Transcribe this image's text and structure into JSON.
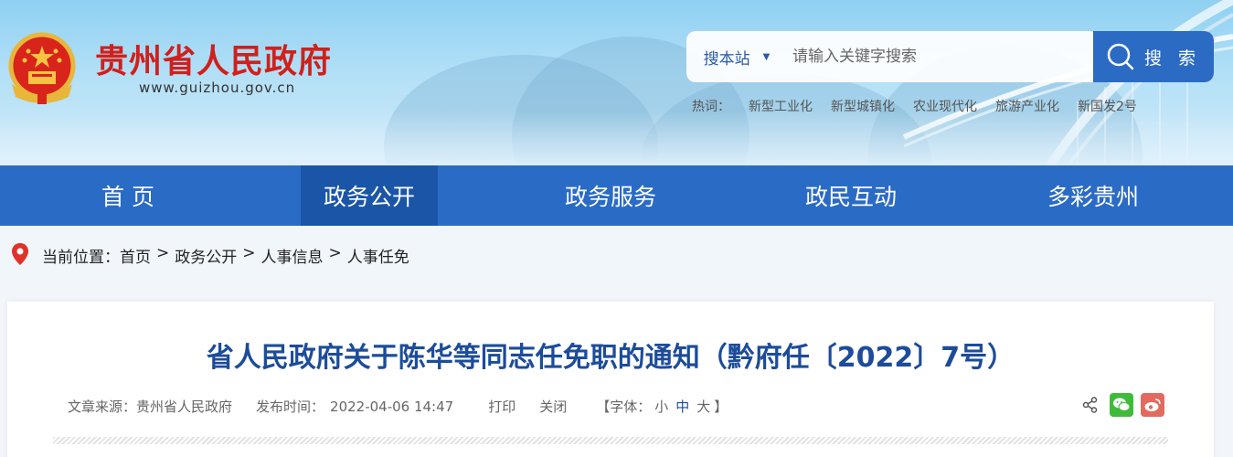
{
  "header": {
    "site_name": "贵州省人民政府",
    "site_url": "www.guizhou.gov.cn",
    "emblem_icon": "national-emblem-icon",
    "accent_color": "#d0201b"
  },
  "search": {
    "scope_label": "搜本站",
    "placeholder": "请输入关键字搜索",
    "button_label": "搜 索",
    "button_color": "#2c6bc4"
  },
  "hotwords": {
    "label": "热词：",
    "items": [
      "新型工业化",
      "新型城镇化",
      "农业现代化",
      "旅游产业化",
      "新国发2号"
    ]
  },
  "nav": {
    "color": "#2a6bc6",
    "active_color": "#1a55a8",
    "items": [
      {
        "label": "首 页",
        "active": false
      },
      {
        "label": "政务公开",
        "active": true
      },
      {
        "label": "政务服务",
        "active": false
      },
      {
        "label": "政民互动",
        "active": false
      },
      {
        "label": "多彩贵州",
        "active": false
      }
    ]
  },
  "breadcrumb": {
    "prefix": "当前位置：",
    "items": [
      "首页",
      "政务公开",
      "人事信息",
      "人事任免"
    ],
    "separator": ">"
  },
  "article": {
    "title": "省人民政府关于陈华等同志任免职的通知（黔府任〔2022〕7号）",
    "source": "文章来源：贵州省人民政府",
    "published_label": "发布时间：",
    "published_value": "2022-04-06 14:47",
    "print_label": "打印",
    "close_label": "关闭",
    "font_size_prefix": "【字体：",
    "font_sizes": [
      "小",
      "中",
      "大"
    ],
    "font_size_suffix": "】",
    "current_font_size": "中",
    "share_icons": [
      "share-icon",
      "wechat-icon",
      "weibo-icon"
    ]
  }
}
